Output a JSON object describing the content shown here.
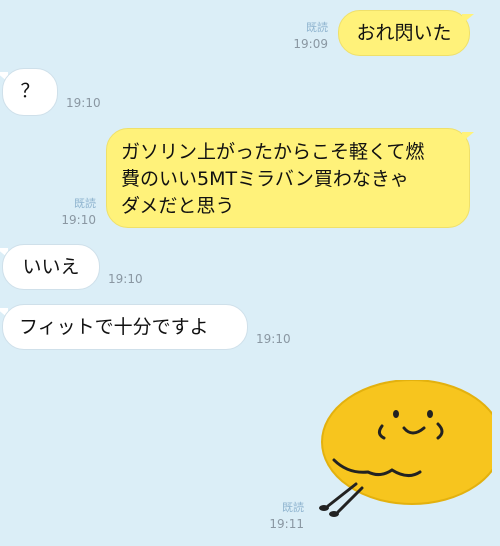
{
  "colors": {
    "background": "#dbeef7",
    "outgoing_bubble": "#fff27a",
    "incoming_bubble": "#ffffff",
    "read_label": "#8fb4cf",
    "timestamp": "#8a97a2",
    "sticker_face": "#f7c51e"
  },
  "messages": [
    {
      "direction": "out",
      "text": "おれ閃いた",
      "read": "既読",
      "time": "19:09"
    },
    {
      "direction": "in",
      "text": "？",
      "time": "19:10"
    },
    {
      "direction": "out",
      "lines": [
        "ガソリン上がったからこそ軽くて燃",
        "費のいい5MTミラバン買わなきゃ",
        "ダメだと思う"
      ],
      "read": "既読",
      "time": "19:10"
    },
    {
      "direction": "in",
      "text": "いいえ",
      "time": "19:10"
    },
    {
      "direction": "in",
      "text": "フィットで十分ですよ",
      "time": "19:10"
    },
    {
      "direction": "out",
      "type": "sticker",
      "sticker_icon": "smiling-face-sticker-icon",
      "read": "既読",
      "time": "19:11"
    }
  ]
}
